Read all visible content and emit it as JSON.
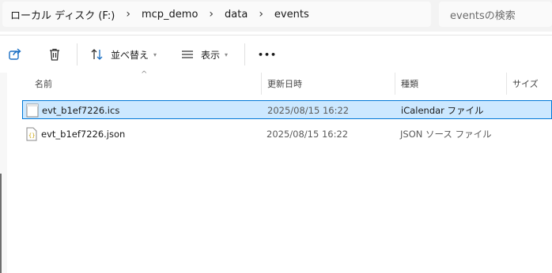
{
  "address": {
    "crumbs": [
      "ローカル ディスク (F:)",
      "mcp_demo",
      "data",
      "events"
    ],
    "separator": "›"
  },
  "search": {
    "placeholder": "eventsの検索"
  },
  "toolbar": {
    "sort_label": "並べ替え",
    "view_label": "表示",
    "more_label": "•••"
  },
  "columns": {
    "name": "名前",
    "modified": "更新日時",
    "type": "種類",
    "size": "サイズ"
  },
  "files": [
    {
      "name": "evt_b1ef7226.ics",
      "modified": "2025/08/15 16:22",
      "type": "iCalendar ファイル",
      "icon": "calendar-file-icon",
      "selected": true
    },
    {
      "name": "evt_b1ef7226.json",
      "modified": "2025/08/15 16:22",
      "type": "JSON ソース ファイル",
      "icon": "json-file-icon",
      "selected": false
    }
  ],
  "colors": {
    "selection_bg": "#cce8ff",
    "selection_border": "#0078d7"
  }
}
